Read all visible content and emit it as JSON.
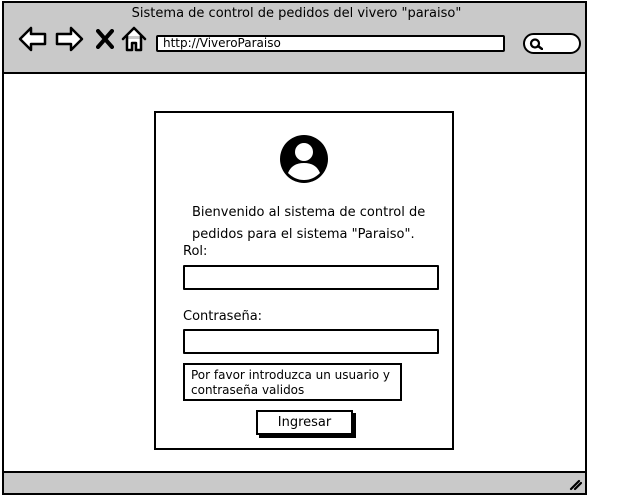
{
  "window": {
    "title": "Sistema de control de pedidos del vivero \"paraiso\"",
    "url": "http://ViveroParaiso"
  },
  "icons": {
    "back": "arrow-left-icon",
    "forward": "arrow-right-icon",
    "stop": "close-icon",
    "home": "home-icon",
    "search": "search-icon",
    "user": "user-avatar-icon",
    "resize": "resize-grip-icon"
  },
  "login": {
    "welcome": "Bienvenido al sistema de control de pedidos para el sistema \"Paraiso\".",
    "rol_label": "Rol:",
    "rol_value": "",
    "password_label": "Contraseña:",
    "password_value": "",
    "message": "Por favor introduzca un usuario y contraseña validos",
    "submit_label": "Ingresar"
  },
  "colors": {
    "chrome": "#c9c9c9",
    "border": "#000000",
    "background": "#ffffff"
  }
}
